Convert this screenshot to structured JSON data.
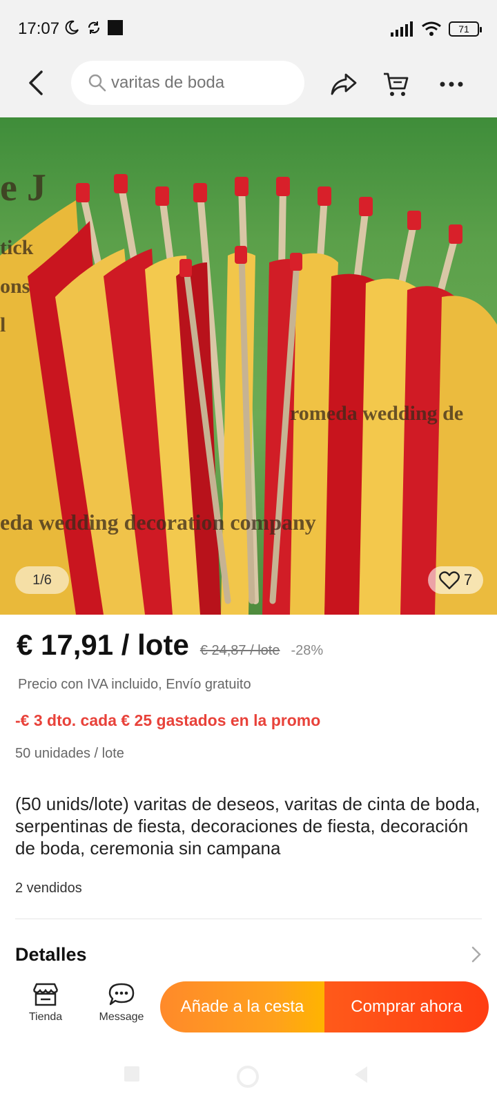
{
  "status_bar": {
    "time": "17:07",
    "battery": "71"
  },
  "search": {
    "placeholder": "varitas de boda"
  },
  "image": {
    "counter": "1/6",
    "likes": "7",
    "watermark_lines": [
      "e J",
      "tick",
      "ons",
      "l"
    ],
    "watermark_mid": "romeda wedding de",
    "watermark_bottom": "eda wedding decoration company"
  },
  "price": {
    "current": "€ 17,91 / lote",
    "original": "€ 24,87 / lote",
    "discount": "-28%",
    "vat_note": "Precio con IVA incluido, Envío gratuito",
    "promo": "-€ 3 dto. cada € 25 gastados en la promo",
    "units": "50 unidades / lote"
  },
  "product": {
    "title": "(50 unids/lote) varitas de deseos, varitas de cinta de boda, serpentinas de fiesta, decoraciones de fiesta, decoración de boda, ceremonia sin campana",
    "sold": "2 vendidos",
    "details_label": "Detalles"
  },
  "bottom_bar": {
    "store_label": "Tienda",
    "message_label": "Message",
    "cart_button": "Añade a la cesta",
    "buy_button": "Comprar ahora"
  },
  "colors": {
    "promo_red": "#e8423a",
    "cart_orange": "#ffa11c",
    "buy_red": "#ff3d12"
  }
}
